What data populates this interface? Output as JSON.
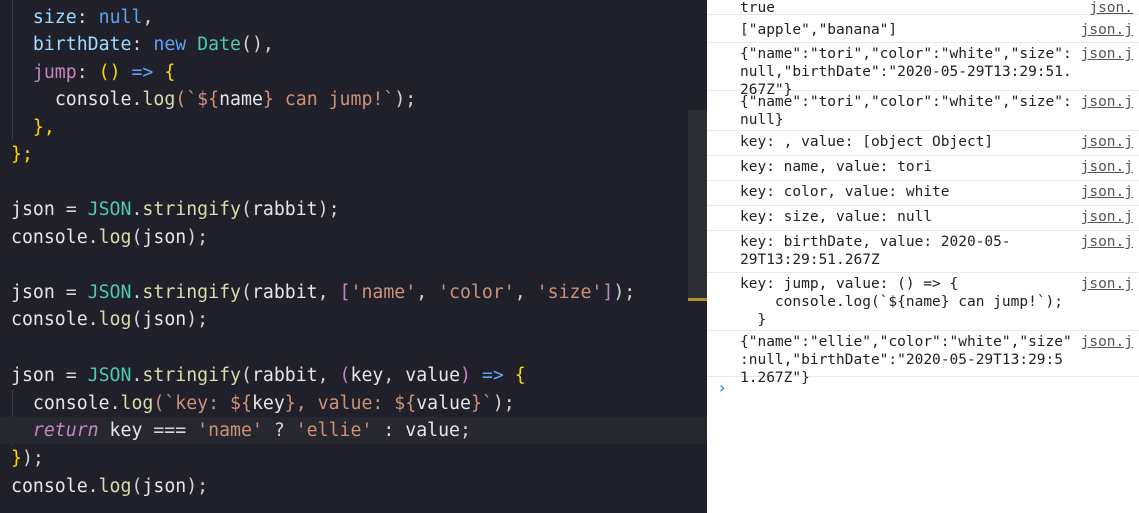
{
  "editor": {
    "lines": [
      {
        "tokens": [
          [
            "  ",
            "t-plain"
          ],
          [
            "size",
            "t-key"
          ],
          [
            ": ",
            "t-op"
          ],
          [
            "null",
            "t-kwb"
          ],
          [
            ",",
            "t-op"
          ]
        ]
      },
      {
        "tokens": [
          [
            "  ",
            "t-plain"
          ],
          [
            "birthDate",
            "t-key"
          ],
          [
            ": ",
            "t-op"
          ],
          [
            "new ",
            "t-kwb"
          ],
          [
            "Date",
            "t-cls"
          ],
          [
            "(),",
            "t-op"
          ]
        ]
      },
      {
        "tokens": [
          [
            "  ",
            "t-plain"
          ],
          [
            "jump",
            "t-kw2"
          ],
          [
            ": ",
            "t-op"
          ],
          [
            "() ",
            "t-brace2"
          ],
          [
            "=> ",
            "t-kwb"
          ],
          [
            "{",
            "t-brace2"
          ]
        ]
      },
      {
        "tokens": [
          [
            "    ",
            "t-plain"
          ],
          [
            "console",
            "t-plain"
          ],
          [
            ".",
            "t-op"
          ],
          [
            "log",
            "t-fn"
          ],
          [
            "(`${",
            "t-str"
          ],
          [
            "name",
            "t-plain"
          ],
          [
            "} can jump!`",
            "t-str"
          ],
          [
            ");",
            "t-op"
          ]
        ]
      },
      {
        "tokens": [
          [
            "  ",
            "t-plain"
          ],
          [
            "},",
            "t-brace2"
          ]
        ]
      },
      {
        "tokens": [
          [
            "};",
            "t-brace2"
          ]
        ]
      },
      {
        "tokens": []
      },
      {
        "tokens": [
          [
            "json ",
            "t-plain"
          ],
          [
            "= ",
            "t-op"
          ],
          [
            "JSON",
            "t-cls"
          ],
          [
            ".",
            "t-op"
          ],
          [
            "stringify",
            "t-fn"
          ],
          [
            "(",
            "t-op"
          ],
          [
            "rabbit",
            "t-plain"
          ],
          [
            ");",
            "t-op"
          ]
        ]
      },
      {
        "tokens": [
          [
            "console",
            "t-plain"
          ],
          [
            ".",
            "t-op"
          ],
          [
            "log",
            "t-fn"
          ],
          [
            "(",
            "t-op"
          ],
          [
            "json",
            "t-plain"
          ],
          [
            ");",
            "t-op"
          ]
        ]
      },
      {
        "tokens": []
      },
      {
        "tokens": [
          [
            "json ",
            "t-plain"
          ],
          [
            "= ",
            "t-op"
          ],
          [
            "JSON",
            "t-cls"
          ],
          [
            ".",
            "t-op"
          ],
          [
            "stringify",
            "t-fn"
          ],
          [
            "(",
            "t-op"
          ],
          [
            "rabbit",
            "t-plain"
          ],
          [
            ", ",
            "t-op"
          ],
          [
            "[",
            "t-brace1"
          ],
          [
            "'name'",
            "t-str"
          ],
          [
            ", ",
            "t-op"
          ],
          [
            "'color'",
            "t-str"
          ],
          [
            ", ",
            "t-op"
          ],
          [
            "'size'",
            "t-str"
          ],
          [
            "]",
            "t-brace1"
          ],
          [
            ");",
            "t-op"
          ]
        ]
      },
      {
        "tokens": [
          [
            "console",
            "t-plain"
          ],
          [
            ".",
            "t-op"
          ],
          [
            "log",
            "t-fn"
          ],
          [
            "(",
            "t-op"
          ],
          [
            "json",
            "t-plain"
          ],
          [
            ");",
            "t-op"
          ]
        ]
      },
      {
        "tokens": []
      },
      {
        "tokens": [
          [
            "json ",
            "t-plain"
          ],
          [
            "= ",
            "t-op"
          ],
          [
            "JSON",
            "t-cls"
          ],
          [
            ".",
            "t-op"
          ],
          [
            "stringify",
            "t-fn"
          ],
          [
            "(",
            "t-op"
          ],
          [
            "rabbit",
            "t-plain"
          ],
          [
            ", ",
            "t-op"
          ],
          [
            "(",
            "t-brace1"
          ],
          [
            "key",
            "t-plain"
          ],
          [
            ", ",
            "t-op"
          ],
          [
            "value",
            "t-plain"
          ],
          [
            ") ",
            "t-brace1"
          ],
          [
            "=> ",
            "t-kwb"
          ],
          [
            "{",
            "t-brace2"
          ]
        ]
      },
      {
        "tokens": [
          [
            "  ",
            "t-plain"
          ],
          [
            "console",
            "t-plain"
          ],
          [
            ".",
            "t-op"
          ],
          [
            "log",
            "t-fn"
          ],
          [
            "(`key: ${",
            "t-str"
          ],
          [
            "key",
            "t-plain"
          ],
          [
            "}, value: ${",
            "t-str"
          ],
          [
            "value",
            "t-plain"
          ],
          [
            "}`",
            "t-str"
          ],
          [
            ");",
            "t-op"
          ]
        ]
      },
      {
        "tokens": [
          [
            "  ",
            "t-plain"
          ],
          [
            "return",
            "t-ret"
          ],
          [
            " key ",
            "t-plain"
          ],
          [
            "=== ",
            "t-op"
          ],
          [
            "'name'",
            "t-str"
          ],
          [
            " ? ",
            "t-op"
          ],
          [
            "'ellie'",
            "t-str"
          ],
          [
            " : ",
            "t-op"
          ],
          [
            "value",
            "t-plain"
          ],
          [
            ";",
            "t-op"
          ]
        ]
      },
      {
        "tokens": [
          [
            "}",
            "t-brace2"
          ],
          [
            ");",
            "t-op"
          ]
        ]
      },
      {
        "tokens": [
          [
            "console",
            "t-plain"
          ],
          [
            ".",
            "t-op"
          ],
          [
            "log",
            "t-fn"
          ],
          [
            "(",
            "t-op"
          ],
          [
            "json",
            "t-plain"
          ],
          [
            ");",
            "t-op"
          ]
        ]
      }
    ]
  },
  "console": {
    "messages": [
      {
        "text": "true",
        "source": "json."
      },
      {
        "text": "[\"apple\",\"banana\"]",
        "source": "json.j"
      },
      {
        "text": "{\"name\":\"tori\",\"color\":\"white\",\"size\":\nnull,\"birthDate\":\"2020-05-29T13:29:51.267Z\"}",
        "source": "json.j"
      },
      {
        "text": "{\"name\":\"tori\",\"color\":\"white\",\"size\":\nnull}",
        "source": "json.j"
      },
      {
        "text": "key: , value: [object Object]",
        "source": "json.j"
      },
      {
        "text": "key: name, value: tori",
        "source": "json.j"
      },
      {
        "text": "key: color, value: white",
        "source": "json.j"
      },
      {
        "text": "key: size, value: null",
        "source": "json.j"
      },
      {
        "text": "key: birthDate, value: 2020-05-\n29T13:29:51.267Z",
        "source": "json.j"
      },
      {
        "text": "key: jump, value: () => {\n    console.log(`${name} can jump!`);\n  }",
        "source": "json.j"
      },
      {
        "text": "{\"name\":\"ellie\",\"color\":\"white\",\"size\"\n:null,\"birthDate\":\"2020-05-29T13:29:51.267Z\"}",
        "source": "json.j"
      }
    ],
    "prompt_glyph": "›"
  }
}
